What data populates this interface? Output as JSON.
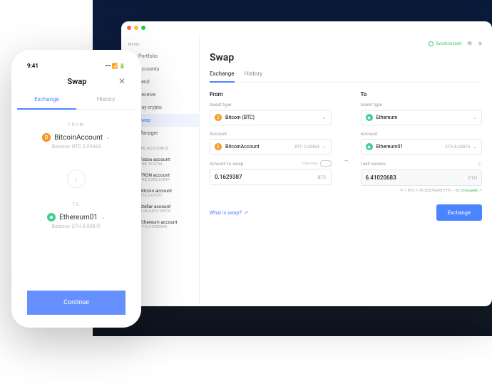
{
  "phone": {
    "time": "9:41",
    "title": "Swap",
    "tabs": {
      "exchange": "Exchange",
      "history": "History"
    },
    "from_label": "FROM",
    "to_label": "TO",
    "from_account": "BitcoinAccount",
    "from_balance": "Balance: BTC 2.09464",
    "to_account": "Ethereum01",
    "to_balance": "Balance: ETH 8.03875",
    "cta": "Continue"
  },
  "desktop": {
    "menu_label": "MENU",
    "starred_label": "STARRED ACCOUNTS",
    "menu": [
      {
        "icon": "📊",
        "label": "Portfolio"
      },
      {
        "icon": "⊞",
        "label": "Accounts"
      },
      {
        "icon": "↗",
        "label": "Send"
      },
      {
        "icon": "↙",
        "label": "Receive"
      },
      {
        "icon": "◉",
        "label": "Buy crypto"
      },
      {
        "icon": "⇄",
        "label": "Swap"
      },
      {
        "icon": "⊡",
        "label": "Manager"
      }
    ],
    "starred": [
      {
        "name": "Tezos account",
        "sub": "TRX 75.9736"
      },
      {
        "name": "TRON account",
        "sub": "TRX 2,398.67047"
      },
      {
        "name": "Bitcoin account",
        "sub": "BTC 0.01027"
      },
      {
        "name": "Stellar account",
        "sub": "XLM 4,872.08974"
      },
      {
        "name": "Ethereum account",
        "sub": "ETH 2.9905345"
      }
    ],
    "sync": "Synchronized",
    "title": "Swap",
    "tabs": {
      "exchange": "Exchange",
      "history": "History"
    },
    "from": {
      "head": "From",
      "asset_label": "Asset type",
      "asset": "Bitcoin (BTC)",
      "account_label": "Account",
      "account": "BitcoinAccount",
      "account_sub": "BTC 2.09464",
      "amount_label": "Amount to swap",
      "usemax": "Use max",
      "amount": "0.1629387",
      "unit": "BTC"
    },
    "to": {
      "head": "To",
      "asset_label": "Asset type",
      "asset": "Ethereum",
      "account_label": "Account",
      "account": "Ethereum01",
      "account_sub": "ETH 8.03875",
      "receive_label": "I will receive",
      "amount": "6.41020683",
      "unit": "ETH"
    },
    "rate": "1 BTC = 39.30576840 ETH",
    "by_label": "By",
    "by": "Changelly",
    "help": "What is swap?",
    "exchange_btn": "Exchange"
  }
}
